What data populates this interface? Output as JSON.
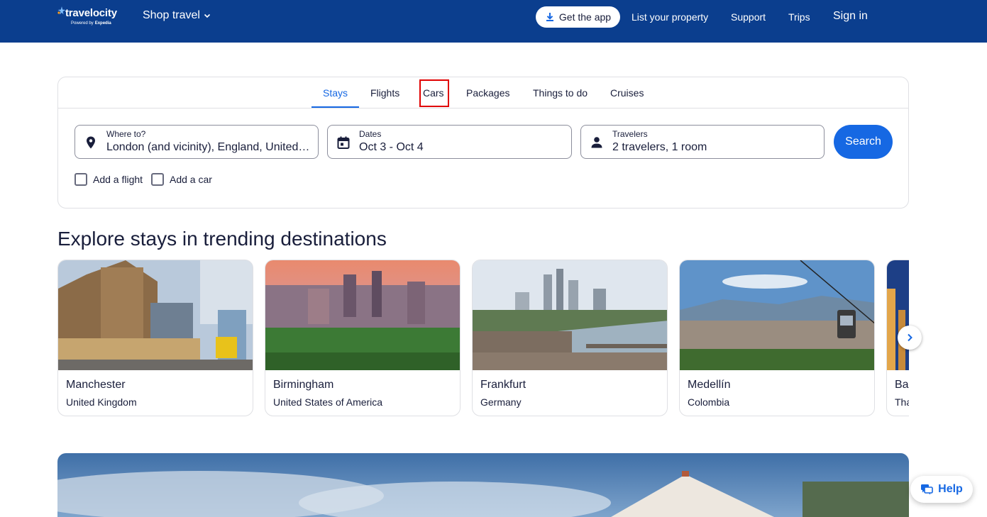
{
  "header": {
    "logo_text": "travelocity",
    "logo_sub_prefix": "Powered by",
    "logo_sub_brand": "Expedia",
    "shop_travel": "Shop travel",
    "get_app": "Get the app",
    "list_property": "List your property",
    "support": "Support",
    "trips": "Trips",
    "sign_in": "Sign in",
    "icons": [
      "logo-star-icon",
      "chevron-down-icon",
      "download-icon"
    ]
  },
  "search": {
    "tabs": [
      {
        "label": "Stays",
        "active": true
      },
      {
        "label": "Flights",
        "active": false
      },
      {
        "label": "Cars",
        "active": false,
        "highlighted": true
      },
      {
        "label": "Packages",
        "active": false
      },
      {
        "label": "Things to do",
        "active": false
      },
      {
        "label": "Cruises",
        "active": false
      }
    ],
    "where": {
      "label": "Where to?",
      "value": "London (and vicinity), England, United Kingdom",
      "icon": "location-pin-icon"
    },
    "dates": {
      "label": "Dates",
      "value": "Oct 3 - Oct 4",
      "icon": "calendar-icon"
    },
    "travelers": {
      "label": "Travelers",
      "value": "2 travelers, 1 room",
      "icon": "person-icon"
    },
    "search_button": "Search",
    "add_flight": "Add a flight",
    "add_car": "Add a car"
  },
  "trending": {
    "title": "Explore stays in trending destinations",
    "destinations": [
      {
        "name": "Manchester",
        "country": "United Kingdom"
      },
      {
        "name": "Birmingham",
        "country": "United States of America"
      },
      {
        "name": "Frankfurt",
        "country": "Germany"
      },
      {
        "name": "Medellín",
        "country": "Colombia"
      },
      {
        "name": "Ba",
        "country": "Tha"
      }
    ],
    "next_icon": "chevron-right-icon"
  },
  "help": {
    "label": "Help",
    "icon": "chat-bubbles-icon"
  },
  "colors": {
    "header_bg": "#0b3e8e",
    "accent": "#1668e3",
    "highlight": "#e00000"
  }
}
